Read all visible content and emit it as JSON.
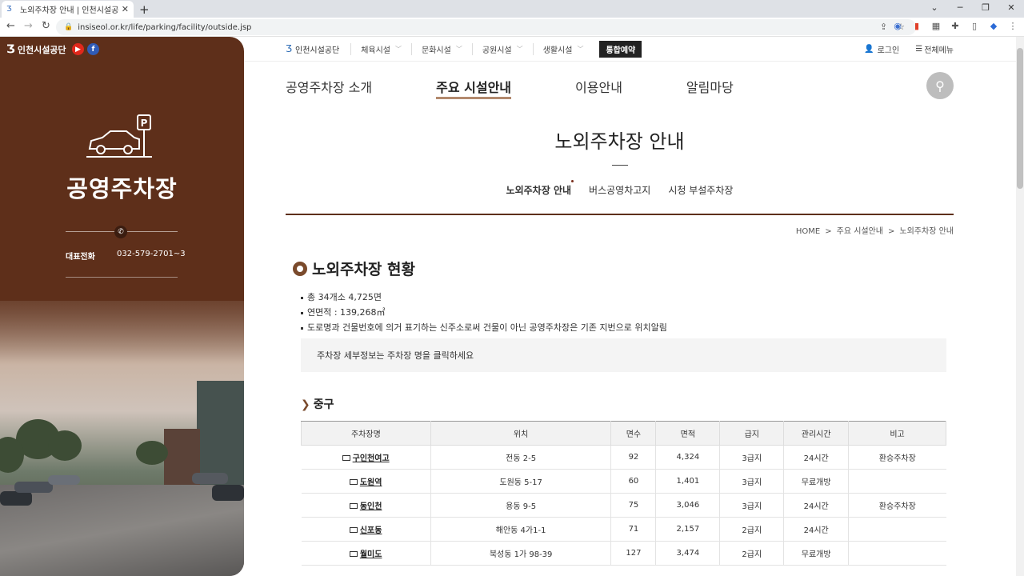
{
  "browser": {
    "tab_title": "노외주차장 안내 | 인천시설공단",
    "tab_close": "✕",
    "new_tab": "+",
    "url": "insiseol.or.kr/life/parking/facility/outside.jsp",
    "window_controls": [
      "⌄",
      "─",
      "❐",
      "✕"
    ]
  },
  "brand_panel": {
    "brand_name": "인천시설공단",
    "sns": {
      "youtube": "▶",
      "facebook": "f"
    },
    "title": "공영주차장",
    "tel_label": "대표전화",
    "tel_number": "032-579-2701~3"
  },
  "utility_nav": {
    "logo": "인천시설공단",
    "items": [
      "체육시설",
      "문화시설",
      "공원시설",
      "생활시설"
    ],
    "booking": "통합예약",
    "login": "로그인",
    "all_menu": "전체메뉴"
  },
  "gnb": {
    "items": [
      "공영주차장 소개",
      "주요 시설안내",
      "이용안내",
      "알림마당"
    ],
    "active_index": 1
  },
  "page": {
    "title": "노외주차장 안내",
    "subtabs": [
      "노외주차장 안내",
      "버스공영차고지",
      "시청 부설주차장"
    ],
    "active_subtab": 0,
    "breadcrumb": [
      "HOME",
      "주요 시설안내",
      "노외주차장 안내"
    ],
    "section_title": "노외주차장 현황",
    "bullets": [
      "총 34개소 4,725면",
      "연면적 : 139,268㎡",
      "도로명과 건물번호에 의거 표기하는 신주소로써 건물이 아닌 공영주차장은 기존 지번으로 위치알림"
    ],
    "notice": "주차장 세부정보는 주차장 명을 클릭하세요",
    "district": "중구"
  },
  "table": {
    "headers": [
      "주차장명",
      "위치",
      "면수",
      "면적",
      "급지",
      "관리시간",
      "비고"
    ],
    "rows": [
      [
        "구인천여고",
        "전동 2-5",
        "92",
        "4,324",
        "3급지",
        "24시간",
        "환승주차장"
      ],
      [
        "도원역",
        "도원동 5-17",
        "60",
        "1,401",
        "3급지",
        "무료개방",
        ""
      ],
      [
        "동인천",
        "용동 9-5",
        "75",
        "3,046",
        "3급지",
        "24시간",
        "환승주차장"
      ],
      [
        "신포동",
        "해안동 4가1-1",
        "71",
        "2,157",
        "2급지",
        "24시간",
        ""
      ],
      [
        "월미도",
        "북성동 1가 98-39",
        "127",
        "3,474",
        "2급지",
        "무료개방",
        ""
      ]
    ]
  }
}
